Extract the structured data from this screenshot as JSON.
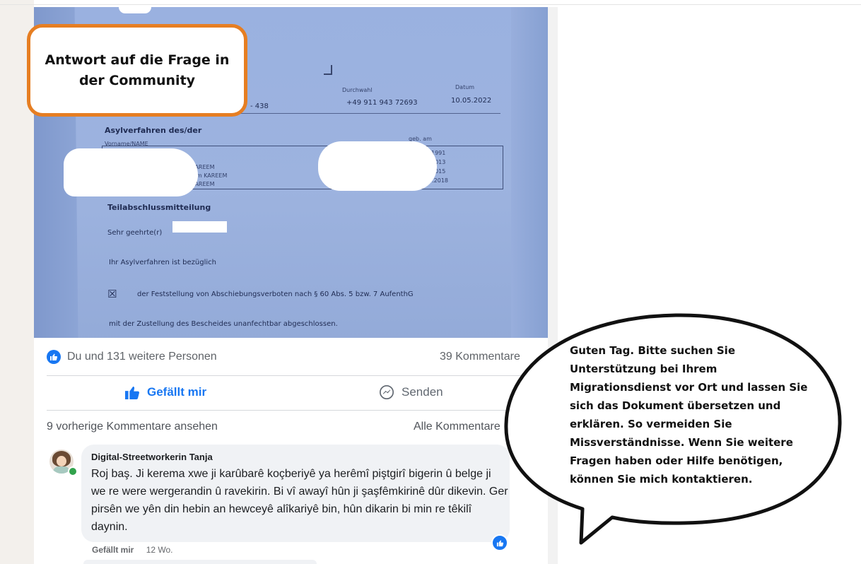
{
  "callout": {
    "text": "Antwort auf die Frage in der Community"
  },
  "document": {
    "phone_label": "Durchwahl",
    "phone": "+49 911 943 72693",
    "date_label": "Datum",
    "date": "10.05.2022",
    "ref_fragment": "- 438",
    "section_title": "Asylverfahren des/der",
    "name_label": "Vorname/NAME",
    "dob_label": "geb. am",
    "names": [
      "m KAREEM",
      "areem KAREEM",
      "m KAREEM"
    ],
    "dates": [
      "1991",
      "2013",
      "2015",
      "0.2018"
    ],
    "notice_title": "Teilabschlussmitteilung",
    "salutation": "Sehr geehrte(r)",
    "body1": "Ihr Asylverfahren ist bezüglich",
    "checkbox": "☒",
    "body2": "der Feststellung von Abschiebungsverboten nach § 60 Abs. 5 bzw. 7 AufenthG",
    "body3": "mit der Zustellung des Bescheides unanfechtbar abgeschlossen."
  },
  "post": {
    "reactions_text": "Du und 131 weitere Personen",
    "comments_count": "39 Kommentare",
    "like_label": "Gefällt mir",
    "send_label": "Senden",
    "prev_comments": "9 vorherige Kommentare ansehen",
    "all_comments": "Alle Kommentare"
  },
  "comment": {
    "author": "Digital-Streetworkerin Tanja",
    "text": "Roj baş. Ji kerema xwe ji karûbarê koçberiyê ya herêmî piştgirî bigerin û belge ji we re were wergerandin û ravekirin. Bi vî awayî hûn ji şaşfêmkirinê dûr dikevin. Ger pirsên we yên din hebin an hewceyê alîkariyê bin, hûn dikarin bi min re têkilî daynin.",
    "like_link": "Gefällt mir",
    "age": "12 Wo."
  },
  "speech_bubble": {
    "text": "Guten Tag. Bitte suchen Sie Unterstützung bei Ihrem Migrationsdienst vor Ort und lassen Sie sich das Dokument übersetzen und erklären. So vermeiden Sie Missverständnisse. Wenn Sie weitere Fragen haben oder Hilfe benötigen, können Sie mich kontaktieren."
  },
  "colors": {
    "accent_blue": "#1877f2",
    "callout_border": "#e67e22",
    "document_tint": "#9ab1e0"
  },
  "icons": [
    "like-thumb-icon",
    "messenger-icon",
    "like-badge-icon",
    "online-status-icon"
  ]
}
